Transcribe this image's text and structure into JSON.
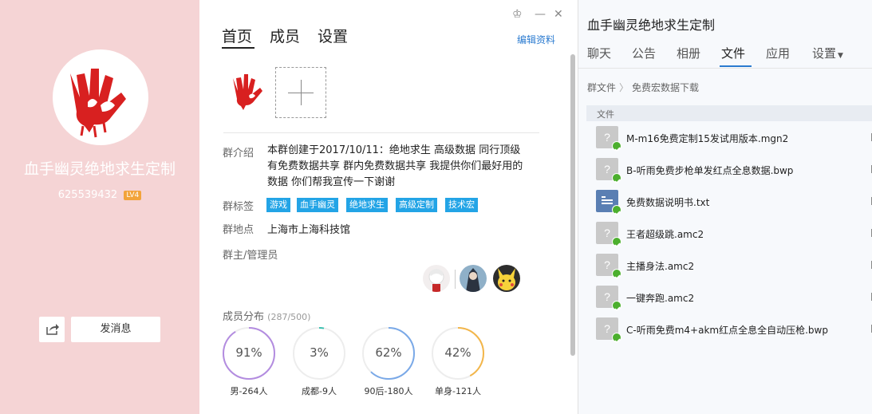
{
  "left_panel": {
    "group_name": "血手幽灵绝地求生定制",
    "group_id": "625539432",
    "level": "LV4",
    "send_message": "发消息"
  },
  "main_tabs": [
    {
      "label": "首页",
      "active": true
    },
    {
      "label": "成员",
      "active": false
    },
    {
      "label": "设置",
      "active": false
    }
  ],
  "edit_profile": "编辑资料",
  "intro": {
    "label": "群介绍",
    "text": "本群创建于2017/10/11：绝地求生  高级数据  同行顶级  有免费数据共享  群内免费数据共享  我提供你们最好用的数据  你们帮我宣传一下谢谢"
  },
  "tags": {
    "label": "群标签",
    "items": [
      "游戏",
      "血手幽灵",
      "绝地求生",
      "高级定制",
      "技术宏"
    ]
  },
  "location": {
    "label": "群地点",
    "value": "上海市上海科技馆"
  },
  "admins": {
    "label": "群主/管理员"
  },
  "distribution": {
    "label": "成员分布",
    "count": "(287/500)",
    "rings": [
      {
        "percent": "91%",
        "value": 0.91,
        "caption": "男-264人",
        "color": "#b38ce0"
      },
      {
        "percent": "3%",
        "value": 0.03,
        "caption": "成都-9人",
        "color": "#3cc0b0"
      },
      {
        "percent": "62%",
        "value": 0.62,
        "caption": "90后-180人",
        "color": "#7aa9e8"
      },
      {
        "percent": "42%",
        "value": 0.42,
        "caption": "单身-121人",
        "color": "#f3b64a"
      }
    ]
  },
  "right_panel": {
    "title": "血手幽灵绝地求生定制",
    "tabs": [
      {
        "label": "聊天",
        "active": false
      },
      {
        "label": "公告",
        "active": false
      },
      {
        "label": "相册",
        "active": false
      },
      {
        "label": "文件",
        "active": true
      },
      {
        "label": "应用",
        "active": false
      },
      {
        "label": "设置",
        "active": false
      }
    ],
    "breadcrumb": [
      "群文件",
      "免费宏数据下载"
    ],
    "column_header": "文件",
    "files": [
      {
        "name": "M-m16免费定制15发试用版本.mgn2",
        "type": "unknown"
      },
      {
        "name": "B-听雨免费步枪单发红点全息数据.bwp",
        "type": "unknown"
      },
      {
        "name": "免费数据说明书.txt",
        "type": "text"
      },
      {
        "name": "王者超级跳.amc2",
        "type": "unknown"
      },
      {
        "name": "主播身法.amc2",
        "type": "unknown"
      },
      {
        "name": "一键奔跑.amc2",
        "type": "unknown"
      },
      {
        "name": "C-听雨免费m4+akm红点全息全自动压枪.bwp",
        "type": "unknown"
      }
    ]
  }
}
